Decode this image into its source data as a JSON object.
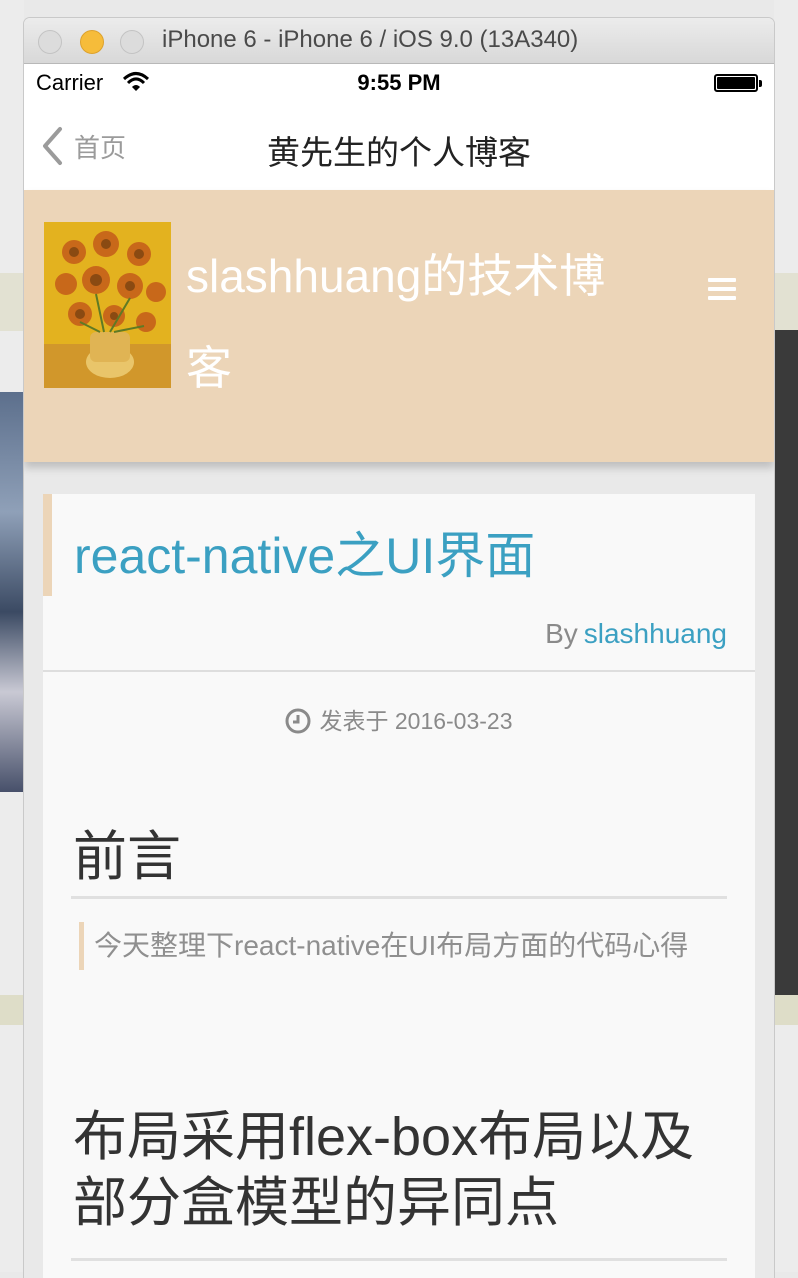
{
  "window": {
    "title": "iPhone 6 - iPhone 6 / iOS 9.0 (13A340)"
  },
  "status_bar": {
    "carrier": "Carrier",
    "time": "9:55 PM"
  },
  "nav_bar": {
    "back_label": "首页",
    "title": "黄先生的个人博客"
  },
  "blog_header": {
    "title": "slashhuang的技术博客",
    "background_color": "#ecd5b8"
  },
  "post": {
    "title": "react-native之UI界面",
    "by_label": "By",
    "author": "slashhuang",
    "date": "发表于 2016-03-23",
    "heading_preface": "前言",
    "quote": "今天整理下react-native在UI布局方面的代码心得",
    "heading_layout": "布局采用flex-box布局以及部分盒模型的异同点",
    "accent_color": "#3ba0c2"
  }
}
